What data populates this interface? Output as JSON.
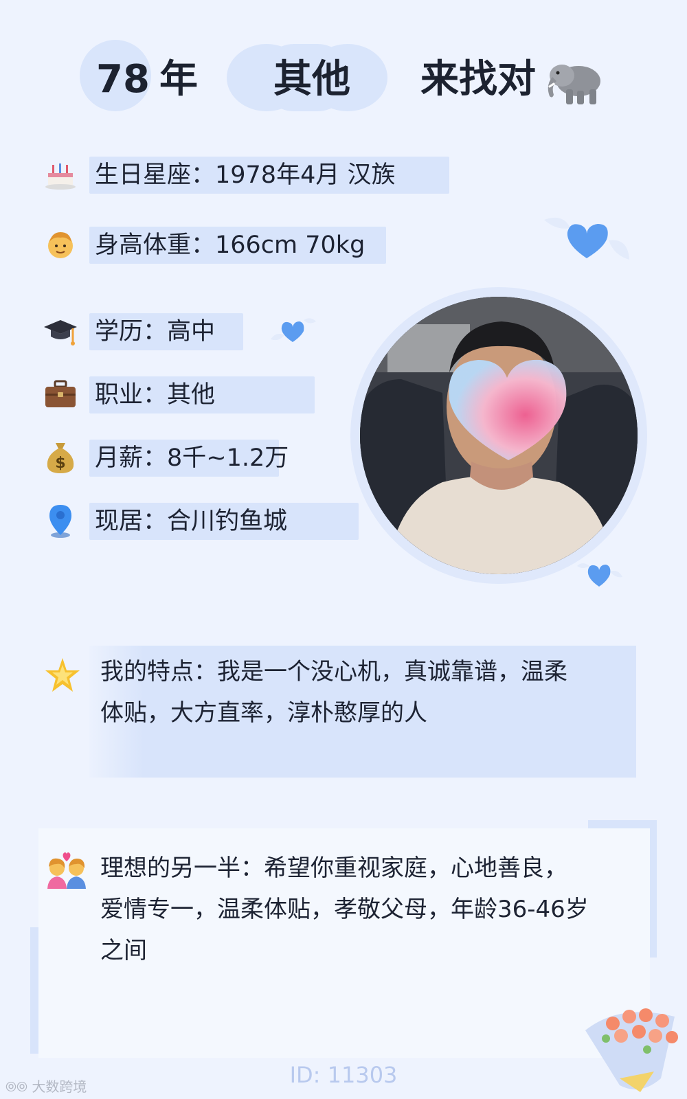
{
  "header": {
    "year": "78",
    "year_suffix": "年",
    "category": "其他",
    "seeking": "来找对",
    "seeking_icon": "elephant-icon"
  },
  "info": [
    {
      "icon": "birthday-cake-icon",
      "text": "生日星座：1978年4月 汉族"
    },
    {
      "icon": "man-face-icon",
      "text": "身高体重：166cm 70kg"
    },
    {
      "icon": "graduation-cap-icon",
      "text": "学历：高中"
    },
    {
      "icon": "briefcase-icon",
      "text": "职业：其他"
    },
    {
      "icon": "money-bag-icon",
      "text": "月薪：8千~1.2万"
    },
    {
      "icon": "location-pin-icon",
      "text": "现居：合川钓鱼城"
    }
  ],
  "traits": {
    "icon": "glowing-star-icon",
    "line1": "我的特点：我是一个没心机，真诚靠谱，温柔",
    "line2": "体贴，大方直率，淳朴憨厚的人"
  },
  "ideal_partner": {
    "icon": "couple-with-heart-icon",
    "line1": "理想的另一半：希望你重视家庭，心地善良，",
    "line2": "爱情专一，温柔体贴，孝敬父母，年龄36-46岁",
    "line3": "之间"
  },
  "footer": {
    "id": "ID: 11303",
    "watermark": "大数跨境"
  },
  "colors": {
    "background": "#eef3fe",
    "highlight": "#d8e4fb",
    "heart": "#5b9cf0"
  }
}
